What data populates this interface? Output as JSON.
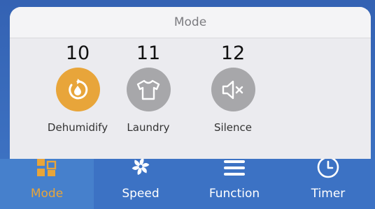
{
  "sheet": {
    "title": "Mode"
  },
  "modes": [
    {
      "number": "10",
      "label": "Dehumidify",
      "icon": "dehumidify-icon",
      "selected": true
    },
    {
      "number": "11",
      "label": "Laundry",
      "icon": "laundry-shirt-icon",
      "selected": false
    },
    {
      "number": "12",
      "label": "Silence",
      "icon": "mute-speaker-icon",
      "selected": false
    }
  ],
  "tabs": [
    {
      "label": "Mode",
      "icon": "mode-grid-icon",
      "selected": true
    },
    {
      "label": "Speed",
      "icon": "fan-icon",
      "selected": false
    },
    {
      "label": "Function",
      "icon": "menu-icon",
      "selected": false
    },
    {
      "label": "Timer",
      "icon": "clock-icon",
      "selected": false
    }
  ],
  "colors": {
    "accent": "#e8a53a",
    "inactive_circle": "#a7a7aa",
    "tabbar": "#3c72c4",
    "sheet": "#ebebef"
  }
}
